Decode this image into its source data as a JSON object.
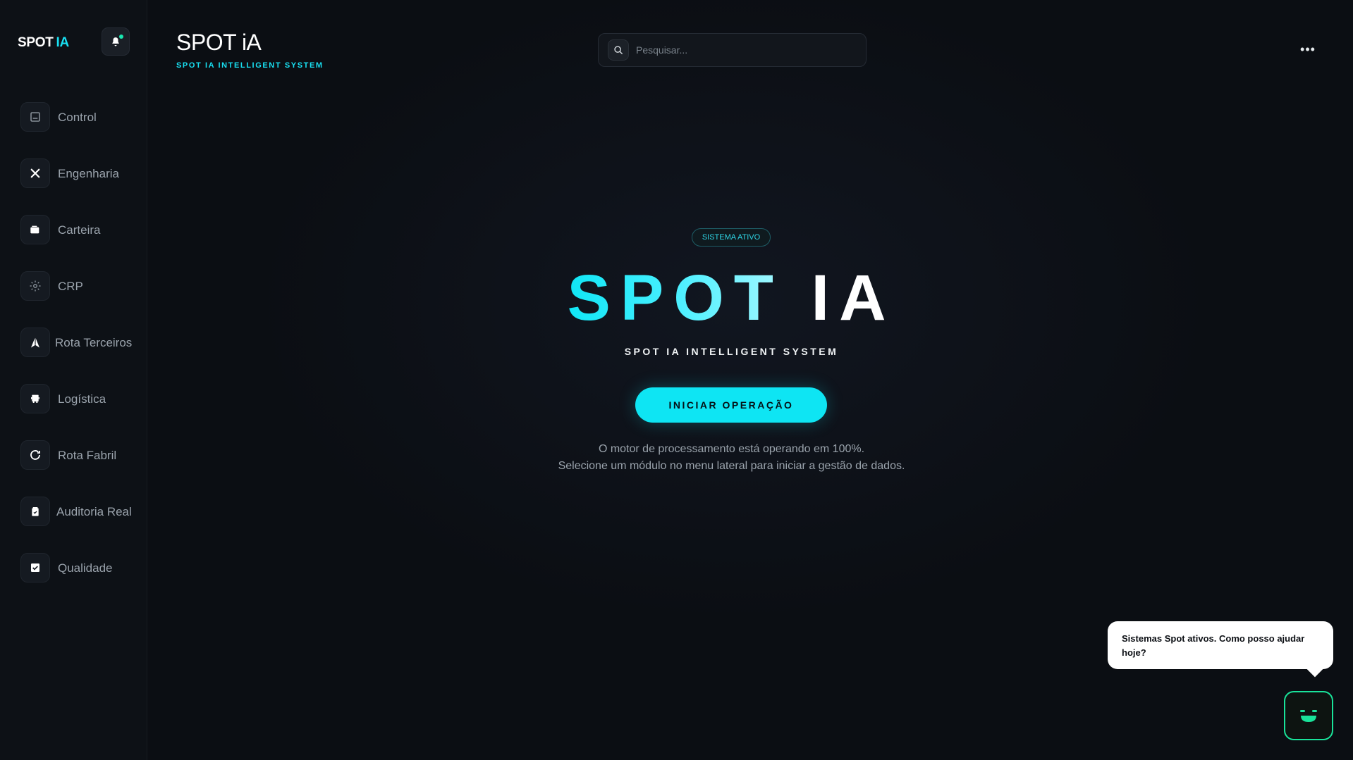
{
  "sidebar": {
    "brand": "SPOT",
    "brand_accent": "IA",
    "items": [
      {
        "label": "Control",
        "icon": "monitor-icon"
      },
      {
        "label": "Engenharia",
        "icon": "tools-icon"
      },
      {
        "label": "Carteira",
        "icon": "wallet-icon"
      },
      {
        "label": "CRP",
        "icon": "gear-icon"
      },
      {
        "label": "Rota Terceiros",
        "icon": "navigation-arrow-icon"
      },
      {
        "label": "Logística",
        "icon": "truck-icon"
      },
      {
        "label": "Rota Fabril",
        "icon": "refresh-icon"
      },
      {
        "label": "Auditoria Real",
        "icon": "clipboard-check-icon"
      },
      {
        "label": "Qualidade",
        "icon": "checkbox-icon"
      }
    ]
  },
  "header": {
    "title": "SPOT iA",
    "subtitle": "SPOT IA INTELLIGENT SYSTEM",
    "search_placeholder": "Pesquisar...",
    "more_label": "•••"
  },
  "hero": {
    "badge": "SISTEMA ATIVO",
    "title_part1": "SPOT",
    "title_part2": "IA",
    "subtitle": "SPOT IA INTELLIGENT SYSTEM",
    "cta_label": "INICIAR OPERAÇÃO",
    "desc_line1": "O motor de processamento está operando em 100%.",
    "desc_line2": "Selecione um módulo no menu lateral para iniciar a gestão de dados."
  },
  "chat": {
    "message": "Sistemas Spot ativos. Como posso ajudar hoje?"
  },
  "colors": {
    "accent": "#0ee5f3",
    "bot_accent": "#19e39a",
    "background": "#0b0e13"
  }
}
